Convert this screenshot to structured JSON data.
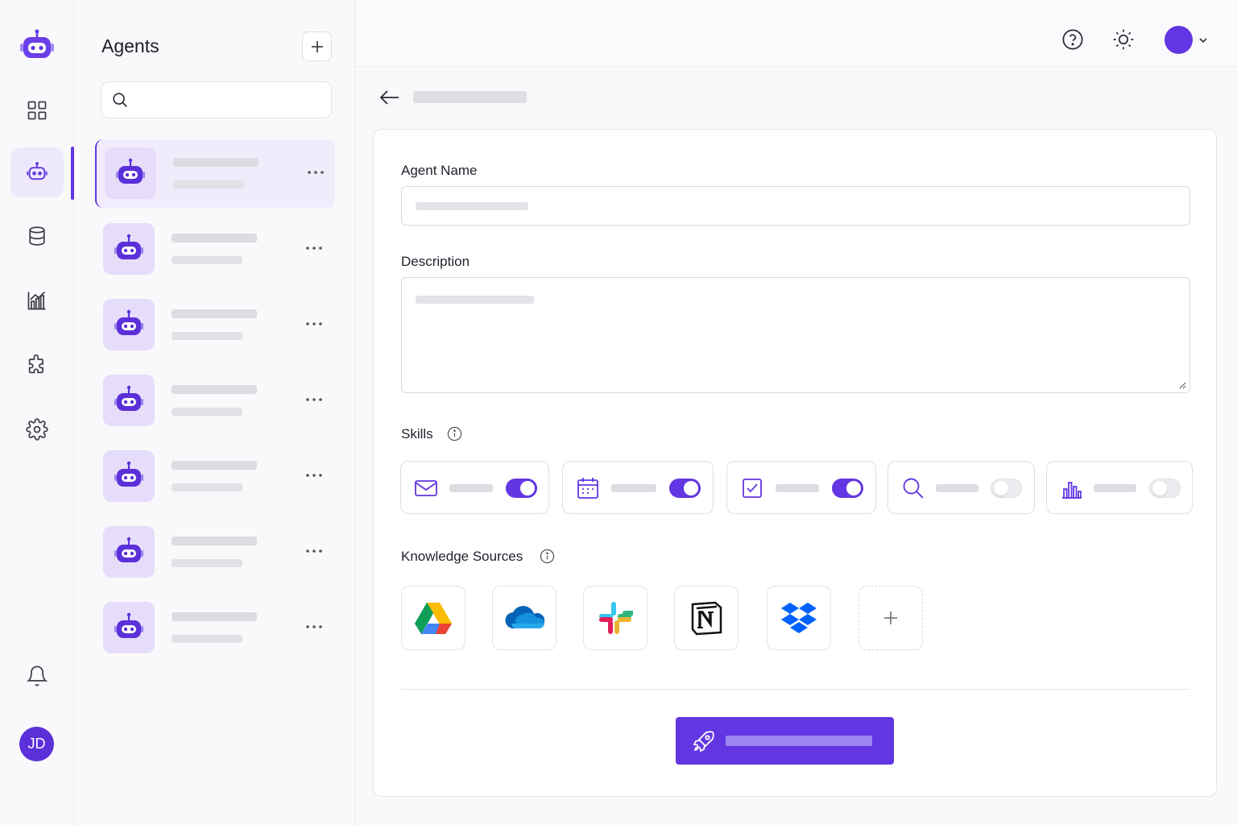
{
  "sidebar": {
    "nav_items": [
      {
        "icon": "grid-icon"
      },
      {
        "icon": "robot-icon",
        "active": true
      },
      {
        "icon": "database-icon"
      },
      {
        "icon": "analytics-icon"
      },
      {
        "icon": "puzzle-icon"
      },
      {
        "icon": "settings-icon"
      }
    ],
    "bottom_icon": "bell-icon",
    "user_initials": "JD"
  },
  "agents_panel": {
    "title": "Agents",
    "add_icon": "plus-icon",
    "search_placeholder": "",
    "agent_count_visible": 7,
    "selected_index": 0
  },
  "header": {
    "icons": [
      "help-icon",
      "sun-icon"
    ],
    "avatar_color": "#6236e2"
  },
  "form": {
    "agent_name_label": "Agent Name",
    "agent_name_value": "",
    "description_label": "Description",
    "description_value": "",
    "skills_label": "Skills",
    "skills": [
      {
        "icon": "mail-icon",
        "enabled": true
      },
      {
        "icon": "calendar-icon",
        "enabled": true
      },
      {
        "icon": "checkbox-icon",
        "enabled": true
      },
      {
        "icon": "search-icon",
        "enabled": false
      },
      {
        "icon": "bar-chart-icon",
        "enabled": false
      }
    ],
    "knowledge_sources_label": "Knowledge Sources",
    "knowledge_sources": [
      "google-drive-icon",
      "onedrive-icon",
      "slack-icon",
      "notion-icon",
      "dropbox-icon",
      "plus-icon"
    ],
    "submit_icon": "rocket-icon"
  },
  "colors": {
    "accent": "#6236e2",
    "accent_light": "#ede8fb"
  }
}
